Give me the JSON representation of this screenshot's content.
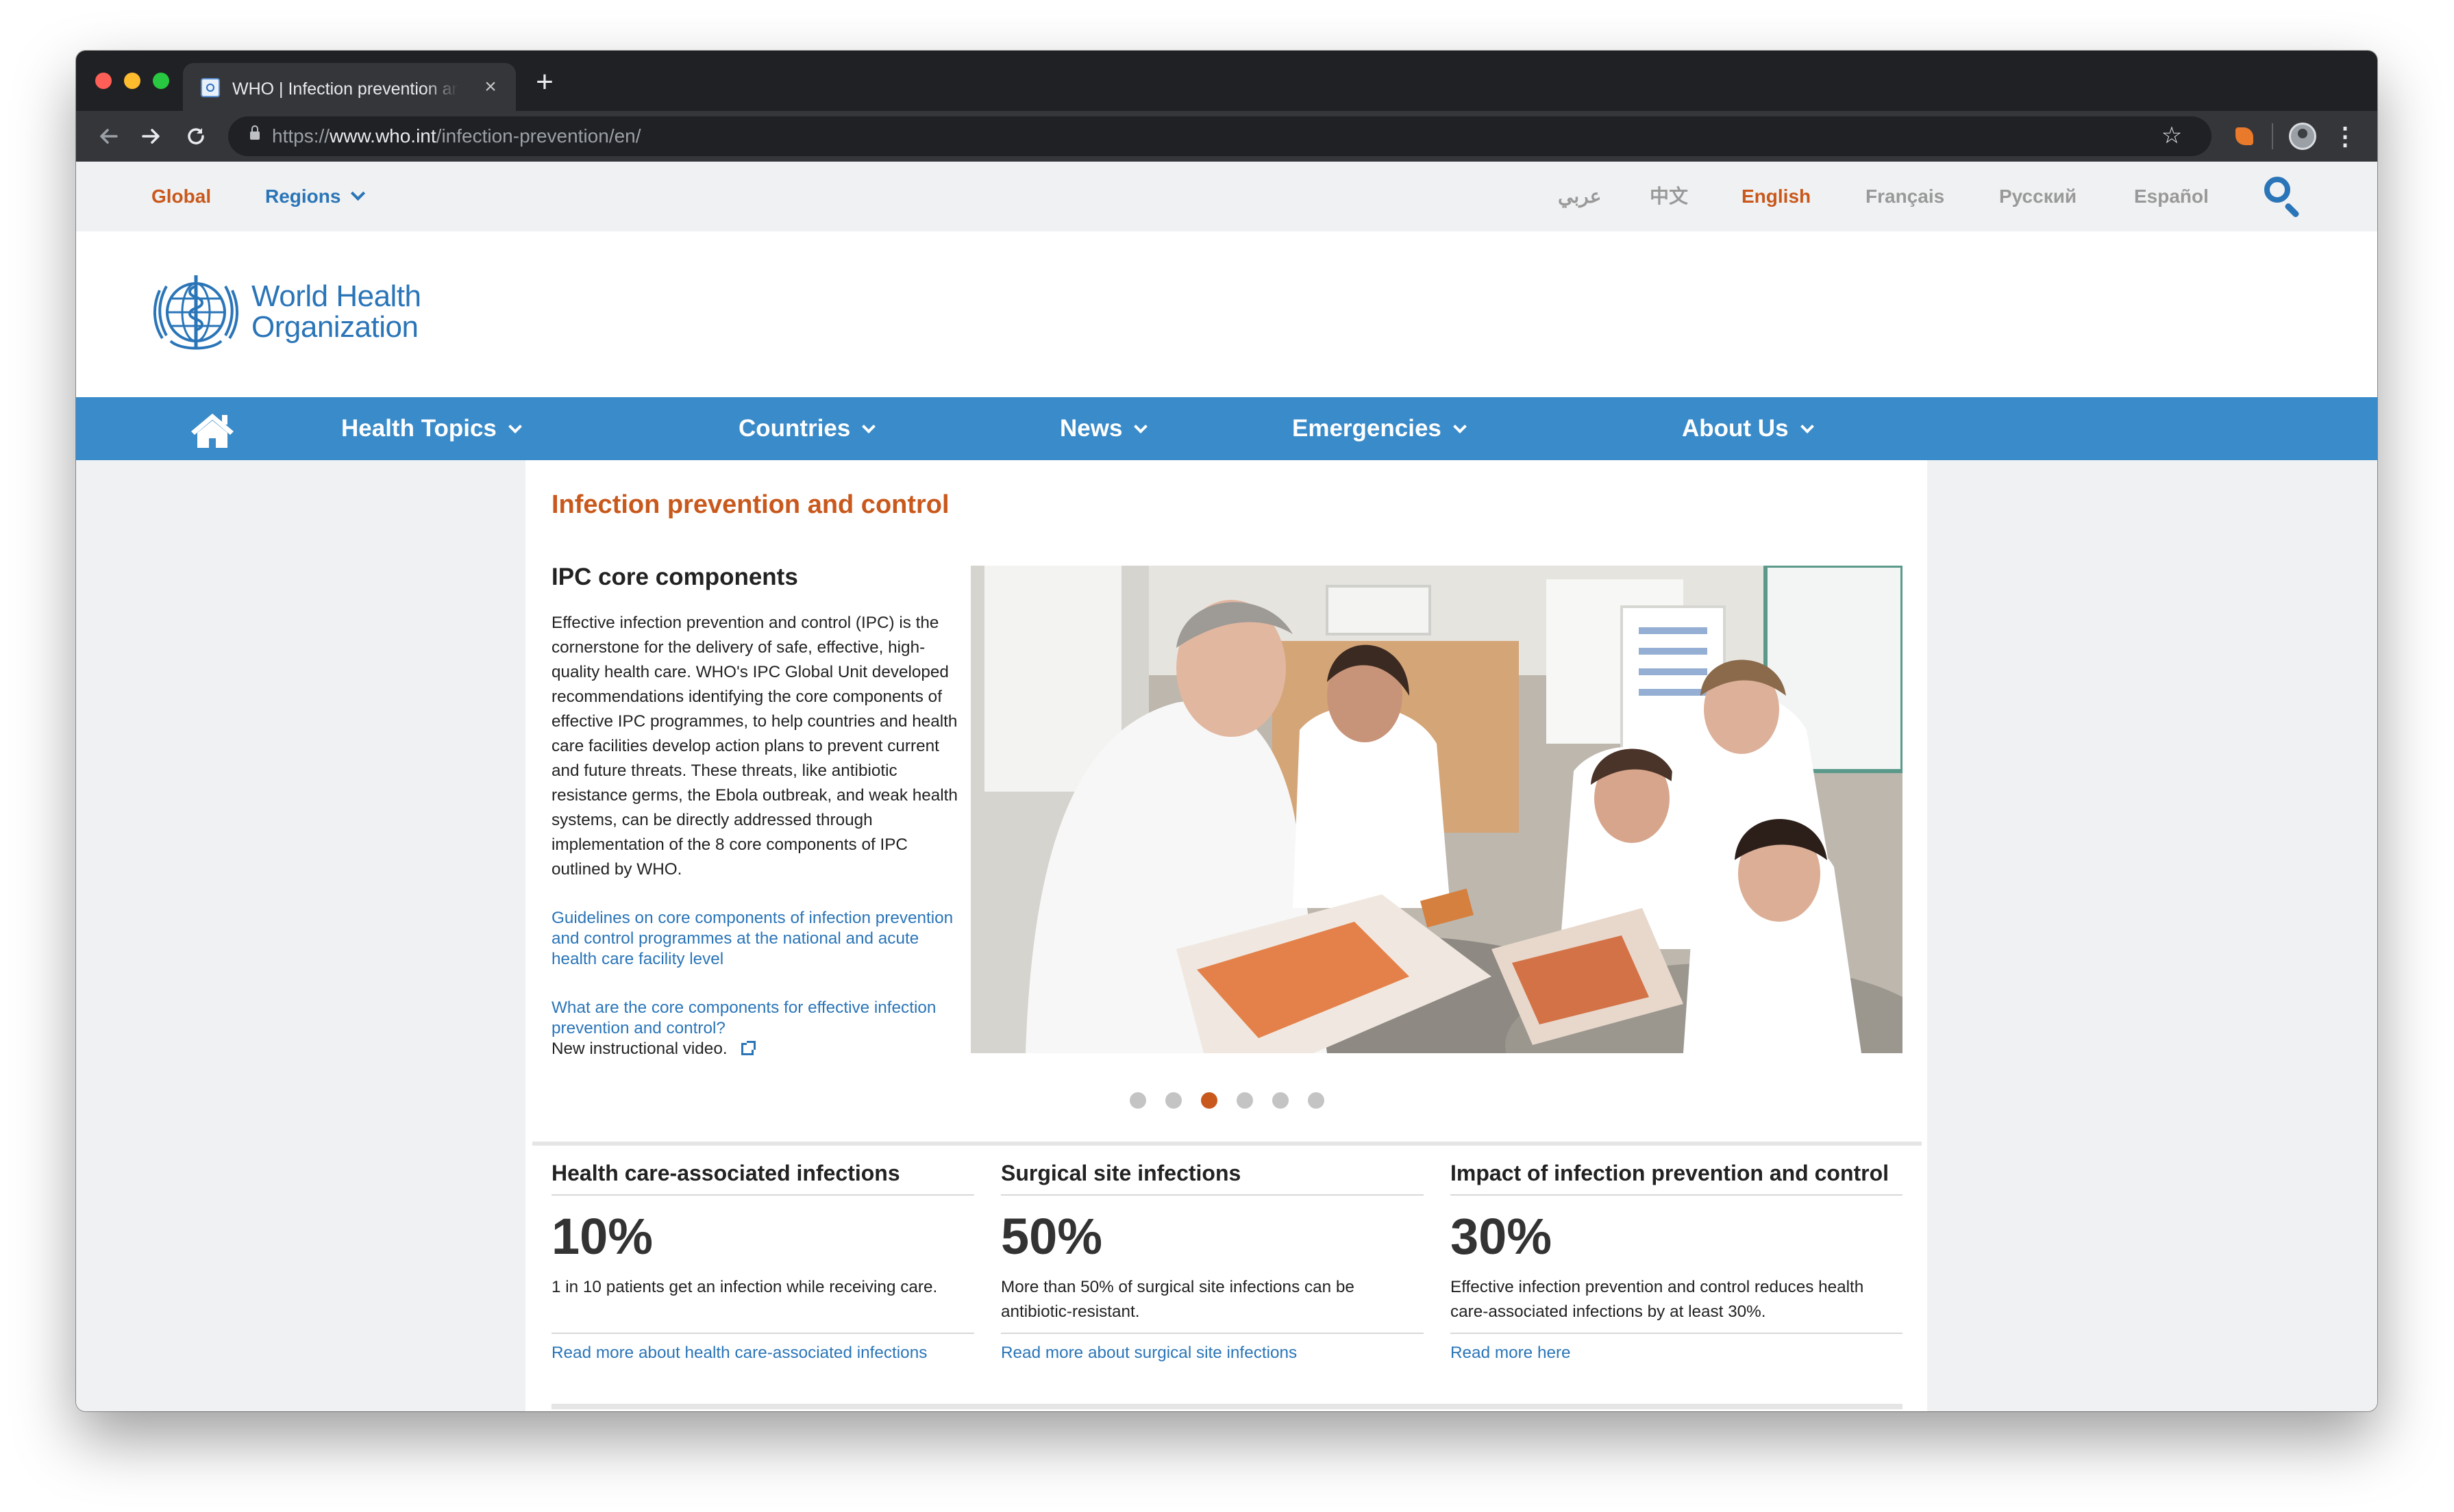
{
  "browser": {
    "tab_title": "WHO | Infection prevention and control",
    "tab_close": "×",
    "new_tab": "+",
    "url_scheme": "https://",
    "url_host": "www.who.int",
    "url_path": "/infection-prevention/en/",
    "icons": {
      "back": "arrow-left-icon",
      "forward": "arrow-right-icon",
      "reload": "reload-icon",
      "lock": "lock-icon",
      "star": "star-icon",
      "menu": "kebab-menu-icon"
    }
  },
  "topbar": {
    "global": "Global",
    "regions": "Regions",
    "languages": [
      "عربي",
      "中文",
      "English",
      "Français",
      "Русский",
      "Español"
    ],
    "active_language": "English"
  },
  "logo": {
    "line1": "World Health",
    "line2": "Organization"
  },
  "mainnav": {
    "items": [
      "Health Topics",
      "Countries",
      "News",
      "Emergencies",
      "About Us"
    ]
  },
  "content": {
    "title": "Infection prevention and control",
    "slide": {
      "heading": "IPC core components",
      "body": "Effective infection prevention and control (IPC) is the cornerstone for the delivery of safe, effective, high-quality health care. WHO's IPC Global Unit developed recommendations identifying the core components of effective IPC programmes, to help countries and health care facilities develop action plans to prevent current and future threats. These threats, like antibiotic resistance germs, the Ebola outbreak, and weak health systems, can be directly addressed through implementation of the 8 core components of IPC outlined by WHO.",
      "link1": "Guidelines on core components of infection prevention and control programmes at the national and acute health care facility level",
      "link2": "What are the core components for effective infection prevention and control?",
      "note": "New instructional video."
    },
    "carousel": {
      "slide_count": 6,
      "active_index": 2
    },
    "stats": [
      {
        "title": "Health care-associated infections",
        "value": "10%",
        "text": "1 in 10 patients get an infection while receiving care.",
        "link": "Read more about health care-associated infections"
      },
      {
        "title": "Surgical site infections",
        "value": "50%",
        "text": "More than 50% of surgical site infections can be antibiotic-resistant.",
        "link": "Read more about surgical site infections"
      },
      {
        "title": "Impact of infection prevention and control",
        "value": "30%",
        "text": "Effective infection prevention and control reduces health care-associated infections by at least 30%.",
        "link": "Read more here"
      }
    ]
  },
  "colors": {
    "accent_orange": "#c9581c",
    "link_blue": "#2a75b8",
    "nav_blue": "#3a8bc9",
    "page_grey": "#f0f1f2"
  }
}
